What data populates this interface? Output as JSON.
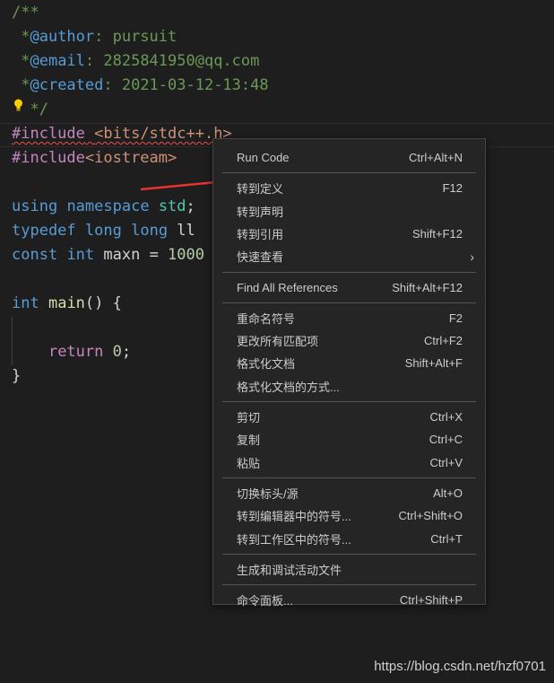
{
  "editor": {
    "lines": [
      {
        "tokens": [
          {
            "t": "/**",
            "c": "comment"
          }
        ]
      },
      {
        "tokens": [
          {
            "t": " *",
            "c": "comment"
          },
          {
            "t": "@author",
            "c": "doctag"
          },
          {
            "t": ": pursuit",
            "c": "comment"
          }
        ]
      },
      {
        "tokens": [
          {
            "t": " *",
            "c": "comment"
          },
          {
            "t": "@email",
            "c": "doctag"
          },
          {
            "t": ": 2825841950@qq.com",
            "c": "comment"
          }
        ]
      },
      {
        "tokens": [
          {
            "t": " *",
            "c": "comment"
          },
          {
            "t": "@created",
            "c": "doctag"
          },
          {
            "t": ": 2021-03-12-13:48",
            "c": "comment"
          }
        ]
      },
      {
        "tokens": [
          {
            "t": "  */",
            "c": "comment"
          }
        ]
      },
      {
        "tokens": [
          {
            "t": "#include",
            "c": "ctrl",
            "sq": true
          },
          {
            "t": " ",
            "c": "plain",
            "sq": true
          },
          {
            "t": "<bits/stdc++.h>",
            "c": "str",
            "sq": true
          }
        ]
      },
      {
        "tokens": [
          {
            "t": "#include",
            "c": "ctrl"
          },
          {
            "t": "<iostream>",
            "c": "str"
          }
        ]
      },
      {
        "tokens": []
      },
      {
        "tokens": [
          {
            "t": "using",
            "c": "kw"
          },
          {
            "t": " ",
            "c": "plain"
          },
          {
            "t": "namespace",
            "c": "kw"
          },
          {
            "t": " ",
            "c": "plain"
          },
          {
            "t": "std",
            "c": "type"
          },
          {
            "t": ";",
            "c": "plain"
          }
        ]
      },
      {
        "tokens": [
          {
            "t": "typedef",
            "c": "kw"
          },
          {
            "t": " ",
            "c": "plain"
          },
          {
            "t": "long",
            "c": "kw"
          },
          {
            "t": " ",
            "c": "plain"
          },
          {
            "t": "long",
            "c": "kw"
          },
          {
            "t": " ll",
            "c": "plain"
          }
        ]
      },
      {
        "tokens": [
          {
            "t": "const",
            "c": "kw"
          },
          {
            "t": " ",
            "c": "plain"
          },
          {
            "t": "int",
            "c": "kw"
          },
          {
            "t": " maxn = ",
            "c": "plain"
          },
          {
            "t": "1000",
            "c": "num"
          }
        ]
      },
      {
        "tokens": []
      },
      {
        "tokens": [
          {
            "t": "int",
            "c": "kw"
          },
          {
            "t": " ",
            "c": "plain"
          },
          {
            "t": "main",
            "c": "fn"
          },
          {
            "t": "() {",
            "c": "plain"
          }
        ]
      },
      {
        "tokens": []
      },
      {
        "tokens": [
          {
            "t": "    ",
            "c": "plain"
          },
          {
            "t": "return",
            "c": "ctrl"
          },
          {
            "t": " ",
            "c": "plain"
          },
          {
            "t": "0",
            "c": "num"
          },
          {
            "t": ";",
            "c": "plain"
          }
        ]
      },
      {
        "tokens": [
          {
            "t": "}",
            "c": "plain"
          }
        ]
      }
    ]
  },
  "context_menu": {
    "items": [
      {
        "label": "Run Code",
        "shortcut": "Ctrl+Alt+N"
      },
      {
        "label": "转到定义",
        "shortcut": "F12"
      },
      {
        "label": "转到声明",
        "shortcut": ""
      },
      {
        "label": "转到引用",
        "shortcut": "Shift+F12"
      },
      {
        "label": "快速查看",
        "shortcut": "",
        "submenu": true
      },
      {
        "label": "Find All References",
        "shortcut": "Shift+Alt+F12"
      },
      {
        "label": "重命名符号",
        "shortcut": "F2"
      },
      {
        "label": "更改所有匹配项",
        "shortcut": "Ctrl+F2"
      },
      {
        "label": "格式化文档",
        "shortcut": "Shift+Alt+F"
      },
      {
        "label": "格式化文档的方式...",
        "shortcut": ""
      },
      {
        "label": "剪切",
        "shortcut": "Ctrl+X"
      },
      {
        "label": "复制",
        "shortcut": "Ctrl+C"
      },
      {
        "label": "粘贴",
        "shortcut": "Ctrl+V"
      },
      {
        "label": "切换标头/源",
        "shortcut": "Alt+O"
      },
      {
        "label": "转到编辑器中的符号...",
        "shortcut": "Ctrl+Shift+O"
      },
      {
        "label": "转到工作区中的符号...",
        "shortcut": "Ctrl+T"
      },
      {
        "label": "生成和调试活动文件",
        "shortcut": ""
      },
      {
        "label": "命令面板...",
        "shortcut": "Ctrl+Shift+P"
      }
    ],
    "submenu_icon": "chevron-right-icon"
  },
  "icons": {
    "lightbulb": "lightbulb-icon",
    "annotation": "red-arrow-annotation"
  },
  "colors": {
    "background": "#1e1e1e",
    "menu_bg": "#252526",
    "arrow": "#e8322e",
    "squiggle": "#f14c4c"
  },
  "watermark": "https://blog.csdn.net/hzf0701"
}
